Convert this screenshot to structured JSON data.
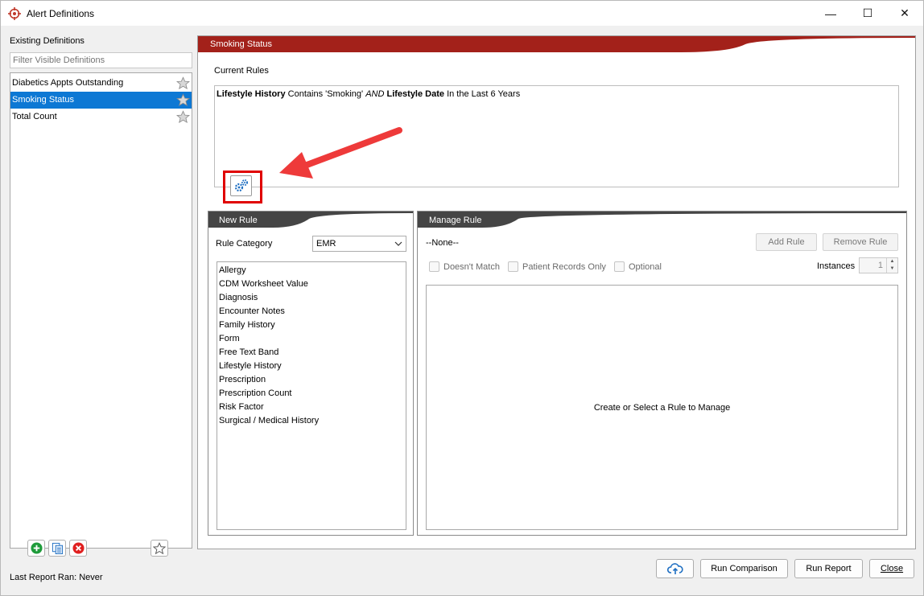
{
  "window": {
    "title": "Alert Definitions",
    "controls": {
      "minimize": "—",
      "maximize": "☐",
      "close": "✕"
    }
  },
  "sidebar": {
    "heading": "Existing Definitions",
    "filter_placeholder": "Filter Visible Definitions",
    "definitions": [
      {
        "label": "Diabetics Appts Outstanding",
        "selected": false
      },
      {
        "label": "Smoking Status",
        "selected": true
      },
      {
        "label": "Total Count",
        "selected": false
      }
    ],
    "last_report_label": "Last Report Ran: Never"
  },
  "main": {
    "header": "Smoking Status",
    "current_rules_label": "Current Rules",
    "rule": {
      "field1": "Lifestyle History",
      "op1": " Contains 'Smoking' ",
      "conj": "AND",
      "field2": " Lifestyle Date",
      "op2": " In the Last 6 Years"
    }
  },
  "new_rule": {
    "header": "New Rule",
    "category_label": "Rule Category",
    "category_value": "EMR",
    "categories": [
      "Allergy",
      "CDM Worksheet Value",
      "Diagnosis",
      "Encounter Notes",
      "Family History",
      "Form",
      "Free Text Band",
      "Lifestyle History",
      "Prescription",
      "Prescription Count",
      "Risk Factor",
      "Surgical / Medical History"
    ]
  },
  "manage_rule": {
    "header": "Manage Rule",
    "none_label": "--None--",
    "add_rule": "Add Rule",
    "remove_rule": "Remove Rule",
    "checks": [
      "Doesn't Match",
      "Patient Records Only",
      "Optional"
    ],
    "instances_label": "Instances",
    "instances_value": "1",
    "empty_message": "Create or Select a Rule to Manage"
  },
  "footer": {
    "run_comparison": "Run Comparison",
    "run_report": "Run Report",
    "close": "Close"
  },
  "colors": {
    "accent_red": "#a3211a",
    "tab_dark": "#454545",
    "selection": "#0d78d4",
    "highlight": "#e00000",
    "annotation_arrow": "#ee3a3a"
  }
}
